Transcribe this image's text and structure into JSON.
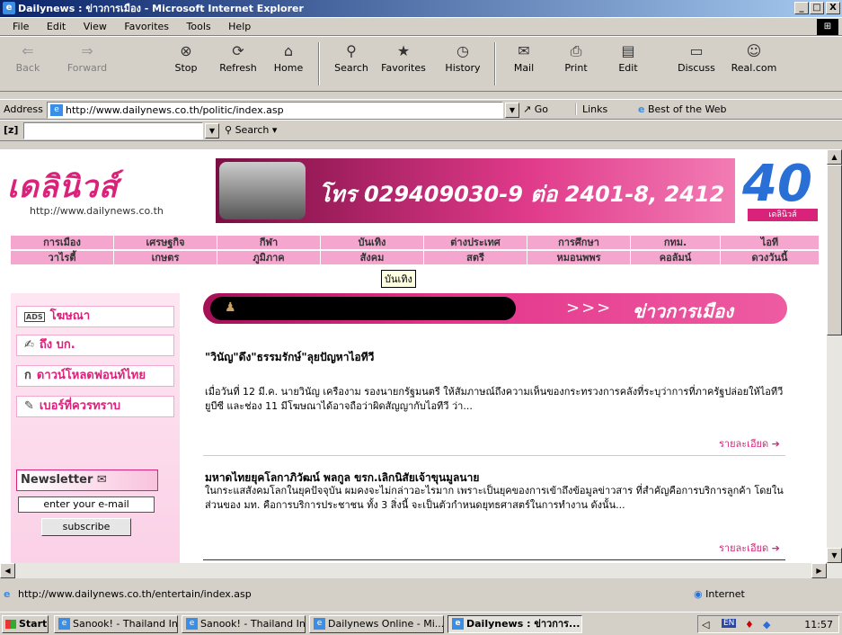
{
  "window": {
    "title": "Dailynews : ข่าวการเมือง - Microsoft Internet Explorer",
    "minimize": "_",
    "maximize": "□",
    "close": "X"
  },
  "menu": [
    "File",
    "Edit",
    "View",
    "Favorites",
    "Tools",
    "Help"
  ],
  "toolbar": {
    "back": "Back",
    "forward": "Forward",
    "stop": "Stop",
    "refresh": "Refresh",
    "home": "Home",
    "search": "Search",
    "favorites": "Favorites",
    "history": "History",
    "mail": "Mail",
    "print": "Print",
    "edit": "Edit",
    "discuss": "Discuss",
    "real": "Real.com"
  },
  "address": {
    "label": "Address",
    "url": "http://www.dailynews.co.th/politic/index.asp",
    "go": "Go",
    "links": "Links",
    "best": "Best of the Web"
  },
  "searchbar": {
    "zlabel": "[z]",
    "search": "Search"
  },
  "site": {
    "logo": "เดลินิวส์",
    "logo_url": "http://www.dailynews.co.th",
    "banner_text": "โทร 029409030-9 ต่อ 2401-8, 2412",
    "anniv": "40",
    "anniv_logo": "เดลินิวส์",
    "nav_row1": [
      "การเมือง",
      "เศรษฐกิจ",
      "กีฬา",
      "บันเทิง",
      "ต่างประเทศ",
      "การศึกษา",
      "กทม.",
      "ไอที"
    ],
    "nav_row2": [
      "วาไรตี้",
      "เกษตร",
      "ภูมิภาค",
      "สังคม",
      "สตรี",
      "หมอนพพร",
      "คอลัมน์",
      "ดวงวันนี้"
    ],
    "tooltip": "บันเทิง",
    "sidebar": [
      {
        "icon": "ADS",
        "label": "โฆษณา"
      },
      {
        "icon": "✍",
        "label": "ถึง บก."
      },
      {
        "icon": "ก",
        "label": "ดาวน์โหลดฟอนท์ไทย"
      },
      {
        "icon": "✎",
        "label": "เบอร์ที่ควรทราบ"
      }
    ],
    "newsletter": {
      "title": "Newsletter",
      "placeholder": "enter your e-mail",
      "subscribe": "subscribe"
    },
    "section_title": "ข่าวการเมือง",
    "section_arrows": ">>>",
    "articles": [
      {
        "headline": "\"วินัญ\"ดึง\"ธรรมรักษ์\"ลุยปัญหาไอทีวี",
        "body": "เมื่อวันที่ 12 มี.ค. นายวินัญ เครืองาม รองนายกรัฐมนตรี ให้สัมภาษณ์ถึงความเห็นของกระทรวงการคลังที่ระบุว่าการที่ภาครัฐปล่อยให้ไอทีวี ยูบีซี และช่อง 11 มีโฆษณาได้อาจถือว่าผิดสัญญากับไอทีวี ว่า...",
        "more": "รายละเอียด ➔"
      },
      {
        "headline": "มหาดไทยยุคโลกาภิวัฒน์ พลกูล ขรก.เลิกนิสัยเจ้าขุนมูลนาย",
        "body": "ในกระแสสังคมโลกในยุคปัจจุบัน ผมคงจะไม่กล่าวอะไรมาก เพราะเป็นยุคของการเข้าถึงข้อมูลข่าวสาร ที่สำคัญคือการบริการลูกค้า โดยในส่วนของ มท. คือการบริการประชาชน ทั้ง 3 สิ่งนี้ จะเป็นตัวกำหนดยุทธศาสตร์ในการทำงาน ดังนั้น...",
        "more": "รายละเอียด ➔"
      }
    ]
  },
  "status": {
    "text": "http://www.dailynews.co.th/entertain/index.asp",
    "zone": "Internet"
  },
  "taskbar": {
    "start": "Start",
    "tasks": [
      "Sanook! - Thailand In...",
      "Sanook! - Thailand In...",
      "Dailynews Online - Mi...",
      "Dailynews : ข่าวการ..."
    ],
    "clock": "11:57",
    "lang": "EN"
  }
}
